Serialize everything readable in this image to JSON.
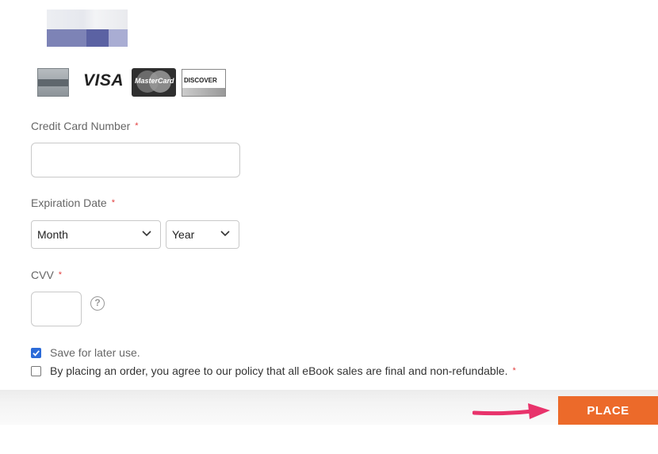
{
  "payment": {
    "card_logos": [
      {
        "name": "american-express",
        "label": ""
      },
      {
        "name": "visa",
        "label": "VISA"
      },
      {
        "name": "mastercard",
        "label": "MasterCard"
      },
      {
        "name": "discover",
        "label": "DISCOVER"
      }
    ],
    "credit_card_number": {
      "label": "Credit Card Number",
      "required": "*",
      "value": ""
    },
    "expiration_date": {
      "label": "Expiration Date",
      "required": "*",
      "month_selected": "Month",
      "year_selected": "Year"
    },
    "cvv": {
      "label": "CVV",
      "required": "*",
      "value": "",
      "help_icon": "?"
    },
    "save_for_later": {
      "label": "Save for later use.",
      "checked": true
    },
    "agreement": {
      "label": "By placing an order, you agree to our policy that all eBook sales are final and non-refundable.",
      "required": "*",
      "checked": false
    },
    "place_order_label": "PLACE ORDER"
  },
  "colors": {
    "accent": "#ec6a2a",
    "required": "#e34040",
    "checkbox": "#2c6bd8",
    "arrow": "#e8336b"
  },
  "icons": [
    "help-icon",
    "chevron-down-icon",
    "checkmark-icon",
    "arrow-icon"
  ]
}
